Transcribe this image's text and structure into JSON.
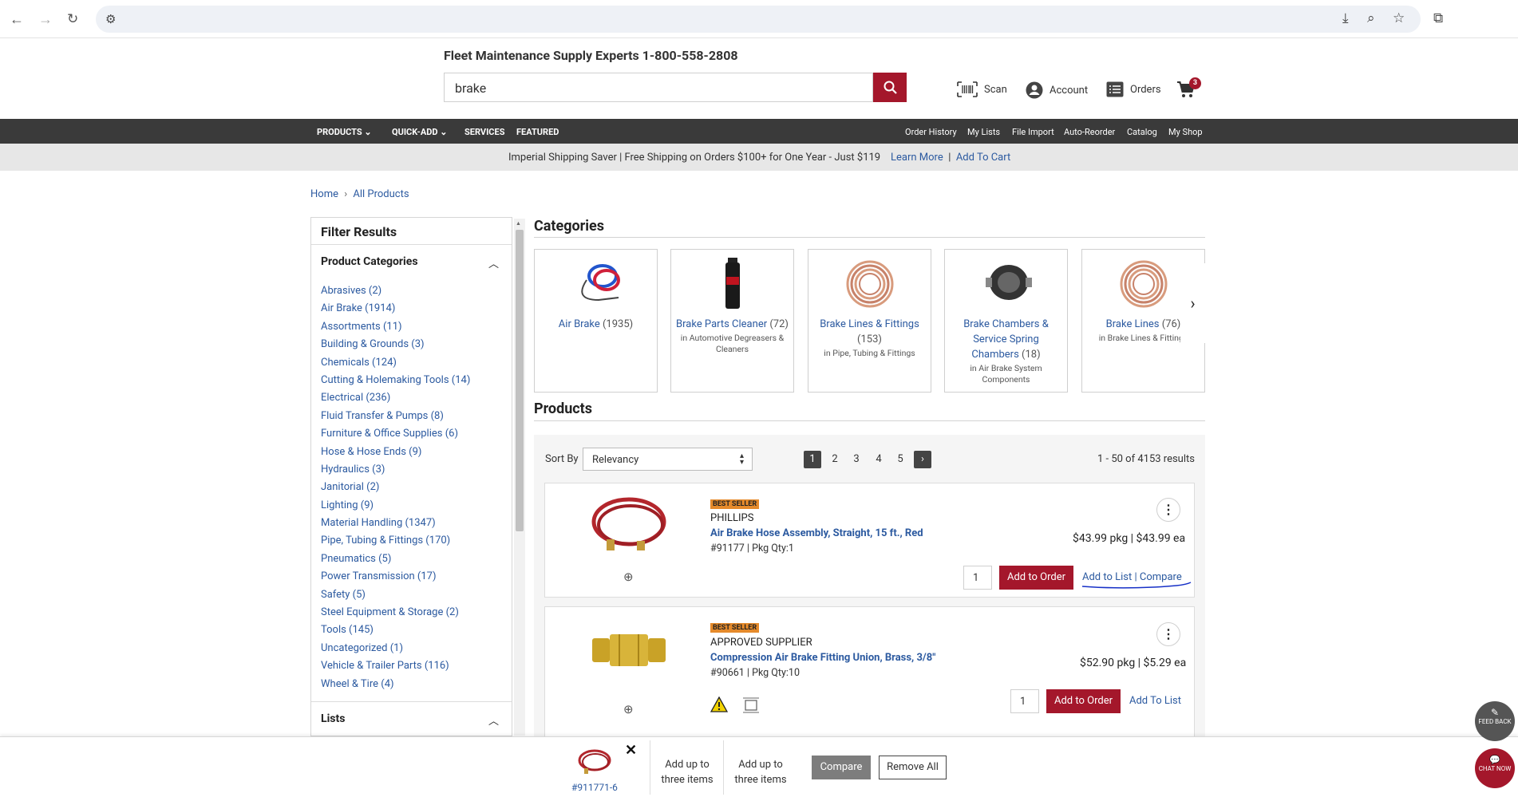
{
  "browser": {
    "url": ""
  },
  "header": {
    "tagline": "Fleet Maintenance Supply Experts  1-800-558-2808",
    "search_value": "brake",
    "scan": "Scan",
    "account": "Account",
    "orders": "Orders",
    "cart_count": "3"
  },
  "nav": {
    "left": [
      "PRODUCTS",
      "QUICK-ADD",
      "SERVICES",
      "FEATURED"
    ],
    "right": [
      "Order History",
      "My Lists",
      "File Import",
      "Auto-Reorder",
      "Catalog",
      "My Shop"
    ]
  },
  "promo": {
    "text": "Imperial Shipping Saver | Free Shipping on Orders $100+ for One Year - Just $119",
    "learn_more": "Learn More",
    "sep": "|",
    "add_to_cart": "Add To Cart"
  },
  "breadcrumb": {
    "home": "Home",
    "sep": "›",
    "current": "All Products"
  },
  "sidebar": {
    "title": "Filter Results",
    "product_categories_title": "Product Categories",
    "categories": [
      "Abrasives (2)",
      "Air Brake (1914)",
      "Assortments (11)",
      "Building & Grounds (3)",
      "Chemicals (124)",
      "Cutting & Holemaking Tools (14)",
      "Electrical (236)",
      "Fluid Transfer & Pumps (8)",
      "Furniture & Office Supplies (6)",
      "Hose & Hose Ends (9)",
      "Hydraulics (3)",
      "Janitorial (2)",
      "Lighting (9)",
      "Material Handling (1347)",
      "Pipe, Tubing & Fittings (170)",
      "Pneumatics (5)",
      "Power Transmission (17)",
      "Safety (5)",
      "Steel Equipment & Storage (2)",
      "Tools (145)",
      "Uncategorized (1)",
      "Vehicle & Trailer Parts (116)",
      "Wheel & Tire (4)"
    ],
    "lists_title": "Lists"
  },
  "categories_heading": "Categories",
  "category_cards": [
    {
      "name": "Air Brake",
      "count": "(1935)",
      "sub": ""
    },
    {
      "name": "Brake Parts Cleaner",
      "count": "(72)",
      "sub": "in Automotive Degreasers & Cleaners"
    },
    {
      "name": "Brake Lines & Fittings",
      "count": "(153)",
      "sub": "in Pipe, Tubing & Fittings"
    },
    {
      "name": "Brake Chambers & Service Spring Chambers",
      "count": "(18)",
      "sub": "in Air Brake System Components"
    },
    {
      "name": "Brake Lines",
      "count": "(76)",
      "sub": "in Brake Lines & Fittings"
    }
  ],
  "products_heading": "Products",
  "sort": {
    "label": "Sort By",
    "value": "Relevancy"
  },
  "pagination": {
    "pages": [
      "1",
      "2",
      "3",
      "4",
      "5"
    ],
    "current": "1",
    "next": "›"
  },
  "results_text": "1 - 50 of 4153 results",
  "products": [
    {
      "badge": "BEST SELLER",
      "brand": "PHILLIPS",
      "name": "Air Brake Hose Assembly, Straight, 15 ft., Red",
      "sku": "#91177 | Pkg Qty:1",
      "price": "$43.99 pkg | $43.99 ea",
      "qty": "1",
      "add": "Add to Order",
      "add_list": "Add to List",
      "compare": "Compare"
    },
    {
      "badge": "BEST SELLER",
      "brand": "APPROVED SUPPLIER",
      "name": "Compression Air Brake Fitting Union, Brass, 3/8\"",
      "sku": "#90661 | Pkg Qty:10",
      "price": "$52.90 pkg | $5.29 ea",
      "qty": "1",
      "add": "Add to Order",
      "add_list": "Add To List"
    }
  ],
  "compare_bar": {
    "item_sku": "#911771-6",
    "slot2": "Add up to three items",
    "slot3": "Add up to three items",
    "compare": "Compare",
    "remove_all": "Remove All"
  },
  "float": {
    "feedback": "FEED BACK",
    "chat": "CHAT NOW"
  },
  "colors": {
    "brand_red": "#a4172b",
    "nav_dark": "#3a3a3a",
    "link_blue": "#2c5aa0",
    "badge_orange": "#e58a2b"
  }
}
